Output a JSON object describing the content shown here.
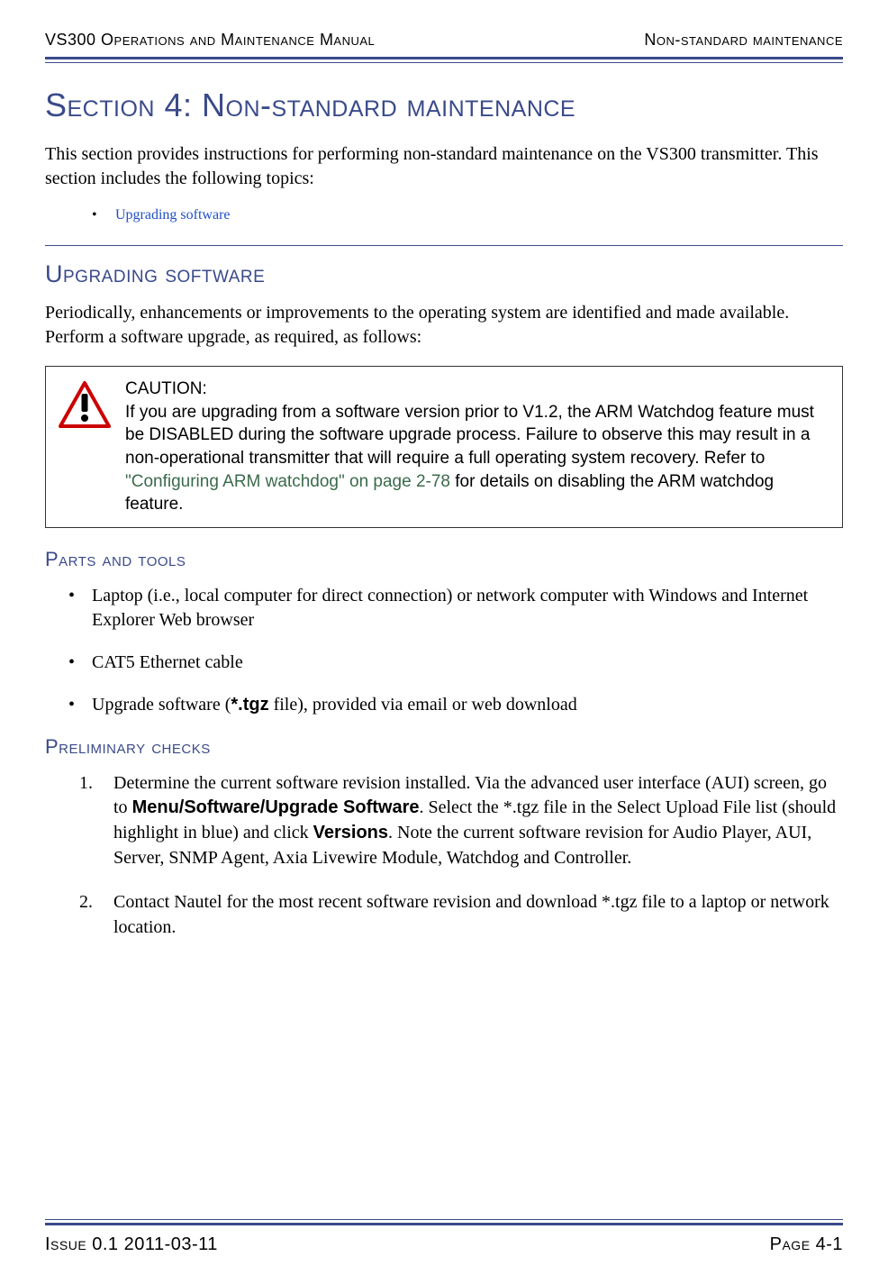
{
  "header": {
    "left": "VS300 Operations and Maintenance Manual",
    "right": "Non-standard maintenance"
  },
  "section_title_prefix": "Section 4:  ",
  "section_title": "Non-standard maintenance",
  "intro": "This section provides instructions for performing non-standard maintenance on the VS300 transmitter. This section includes the following topics:",
  "toc": {
    "item1": "Upgrading software"
  },
  "upgrading": {
    "heading": "Upgrading software",
    "intro": "Periodically, enhancements or improvements to the operating system are identified and made available. Perform a software upgrade, as required, as follows:"
  },
  "caution": {
    "label": "CAUTION:",
    "body_before_xref": "If you are upgrading from a software version prior to V1.2, the ARM Watchdog feature must be DISABLED during the software upgrade process. Failure to observe this may result in a non-operational transmitter that will require a full operating system recovery. Refer to ",
    "xref": "\"Configuring ARM watchdog\" on page 2-78",
    "body_after_xref": " for details on disabling the ARM watchdog feature."
  },
  "parts": {
    "heading": "Parts and tools",
    "item1": "Laptop (i.e., local computer for direct connection) or network computer with Windows and Internet Explorer Web browser",
    "item2": "CAT5 Ethernet cable",
    "item3_before": "Upgrade software (",
    "item3_bold": "*.tgz",
    "item3_after": " file), provided via email or web download"
  },
  "prelim": {
    "heading": "Preliminary checks",
    "step1_a": "Determine the current software revision installed. Via the advanced user interface (AUI) screen, go to ",
    "step1_bold1": "Menu/Software/Upgrade Software",
    "step1_b": ". Select the *.tgz file in the Select Upload File list (should highlight in blue) and click ",
    "step1_bold2": "Versions",
    "step1_c": ". Note the current software revision for Audio Player, AUI, Server, SNMP Agent, Axia Livewire Module, Watchdog and Controller.",
    "step2": "Contact Nautel for the most recent software revision and download *.tgz file to a laptop or network location."
  },
  "footer": {
    "left": "Issue 0.1  2011-03-11",
    "right": "Page 4-1"
  }
}
